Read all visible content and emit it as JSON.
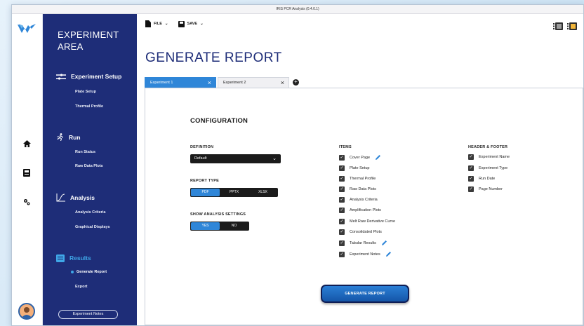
{
  "window": {
    "title": "IRIS PCR Analysis (0.4.0.1)"
  },
  "sidebar": {
    "title_line1": "EXPERIMENT",
    "title_line2": "AREA",
    "sections": [
      {
        "label": "Experiment Setup",
        "icon": "setup-icon",
        "items": [
          "Plate Setup",
          "Thermal Profile"
        ]
      },
      {
        "label": "Run",
        "icon": "run-icon",
        "items": [
          "Run Status",
          "Raw Data Plots"
        ]
      },
      {
        "label": "Analysis",
        "icon": "analysis-icon",
        "items": [
          "Analysis Criteria",
          "Graphical Displays"
        ]
      },
      {
        "label": "Results",
        "icon": "results-icon",
        "items": [
          "Generate Report",
          "Export"
        ]
      }
    ],
    "notes_button": "Experiment Notes"
  },
  "toolbar": {
    "file_label": "FILE",
    "save_label": "SAVE"
  },
  "page_title": "GENERATE REPORT",
  "tabs": [
    {
      "label": "Experiment 1",
      "active": true
    },
    {
      "label": "Experiment 2",
      "active": false
    }
  ],
  "config": {
    "title": "CONFIGURATION",
    "definition_label": "DEFINITION",
    "definition_value": "Default",
    "report_type_label": "REPORT TYPE",
    "report_types": [
      "PDF",
      "PPTX",
      "XLSX"
    ],
    "report_type_selected": "PDF",
    "show_settings_label": "SHOW ANALYSIS SETTINGS",
    "show_settings_options": [
      "YES",
      "NO"
    ],
    "show_settings_selected": "YES"
  },
  "items": {
    "label": "ITEMS",
    "list": [
      "Cover Page",
      "Plate Setup",
      "Thermal Profile",
      "Raw Data Plots",
      "Analysis Criteria",
      "Amplification Plots",
      "Melt Raw Derivative Curve",
      "Consolidated Plots",
      "Tabular Results",
      "Experiment Notes"
    ]
  },
  "header_footer": {
    "label": "HEADER & FOOTER",
    "list": [
      "Experiment Name",
      "Experiment Type",
      "Run Date",
      "Page Number"
    ]
  },
  "generate_button": "GENERATE REPORT",
  "colors": {
    "sidebar": "#1e2d78",
    "accent": "#2f86d8",
    "title": "#1e2d78"
  }
}
